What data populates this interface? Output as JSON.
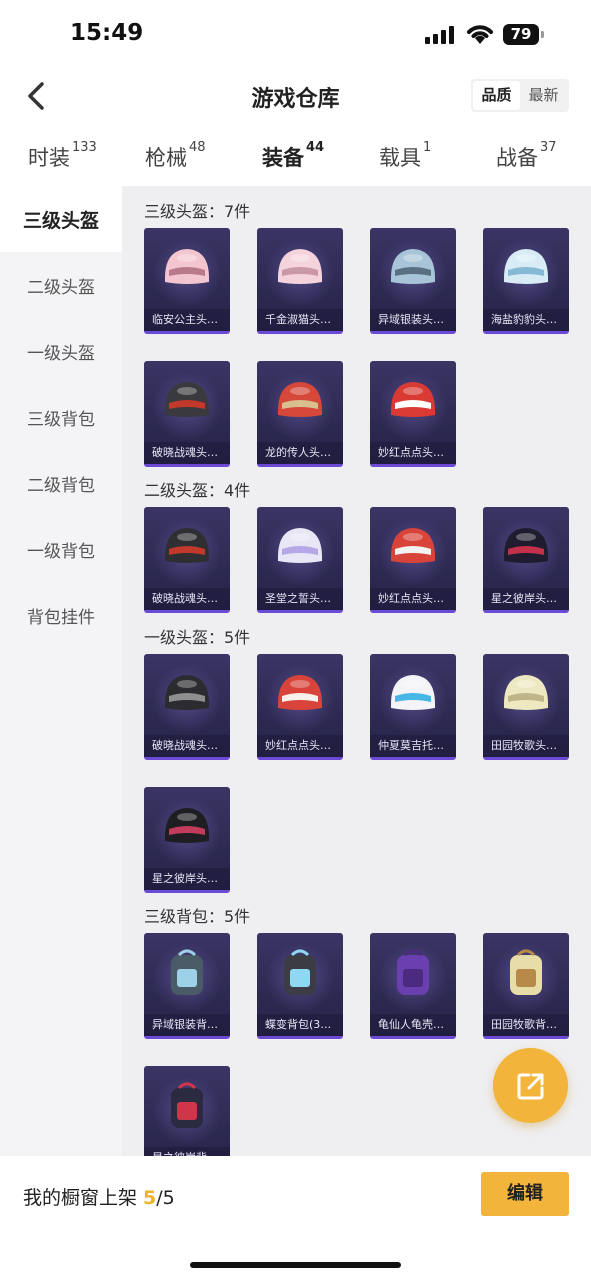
{
  "status_bar": {
    "time": "15:49",
    "battery": "79"
  },
  "header": {
    "title": "游戏仓库",
    "sort_options": [
      "品质",
      "最新"
    ]
  },
  "tabs": [
    {
      "label": "时装",
      "count": "133"
    },
    {
      "label": "枪械",
      "count": "48"
    },
    {
      "label": "装备",
      "count": "44"
    },
    {
      "label": "载具",
      "count": "1"
    },
    {
      "label": "战备",
      "count": "37"
    }
  ],
  "sidebar": [
    "三级头盔",
    "二级头盔",
    "一级头盔",
    "三级背包",
    "二级背包",
    "一级背包",
    "背包挂件"
  ],
  "sections": [
    {
      "title": "三级头盔：7件",
      "items": [
        "临安公主头…",
        "千金淑猫头…",
        "异域银装头…",
        "海盐豹豹头…",
        "破晓战魂头…",
        "龙的传人头…",
        "妙红点点头…"
      ]
    },
    {
      "title": "二级头盔：4件",
      "items": [
        "破晓战魂头…",
        "圣堂之誓头…",
        "妙红点点头…",
        "星之彼岸头…"
      ]
    },
    {
      "title": "一级头盔：5件",
      "items": [
        "破晓战魂头…",
        "妙红点点头…",
        "仲夏莫吉托…",
        "田园牧歌头…",
        "星之彼岸头…"
      ]
    },
    {
      "title": "三级背包：5件",
      "items": [
        "异域银装背…",
        "蝶变背包(3…",
        "龟仙人龟壳…",
        "田园牧歌背…",
        "星之彼岸背…"
      ]
    }
  ],
  "bottom": {
    "label": "我的橱窗上架 ",
    "current": "5",
    "total": "/5",
    "edit": "编辑"
  },
  "colors": {
    "accent": "#f2b43a",
    "card_bg": "#2d2a52"
  }
}
